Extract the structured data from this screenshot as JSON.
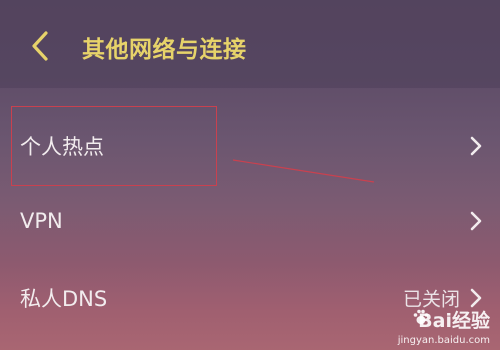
{
  "header": {
    "title": "其他网络与连接",
    "back_icon": "chevron-left-icon",
    "title_color": "#e7d36a"
  },
  "items": [
    {
      "label": "个人热点",
      "value": "",
      "icon": "chevron-right-icon"
    },
    {
      "label": "VPN",
      "value": "",
      "icon": "chevron-right-icon"
    },
    {
      "label": "私人DNS",
      "value": "已关闭",
      "icon": "chevron-right-icon"
    }
  ],
  "annotation": {
    "box_color": "#c9414f"
  },
  "watermark": {
    "brand": "Bai经验",
    "url": "jingyan.baidu.com"
  }
}
